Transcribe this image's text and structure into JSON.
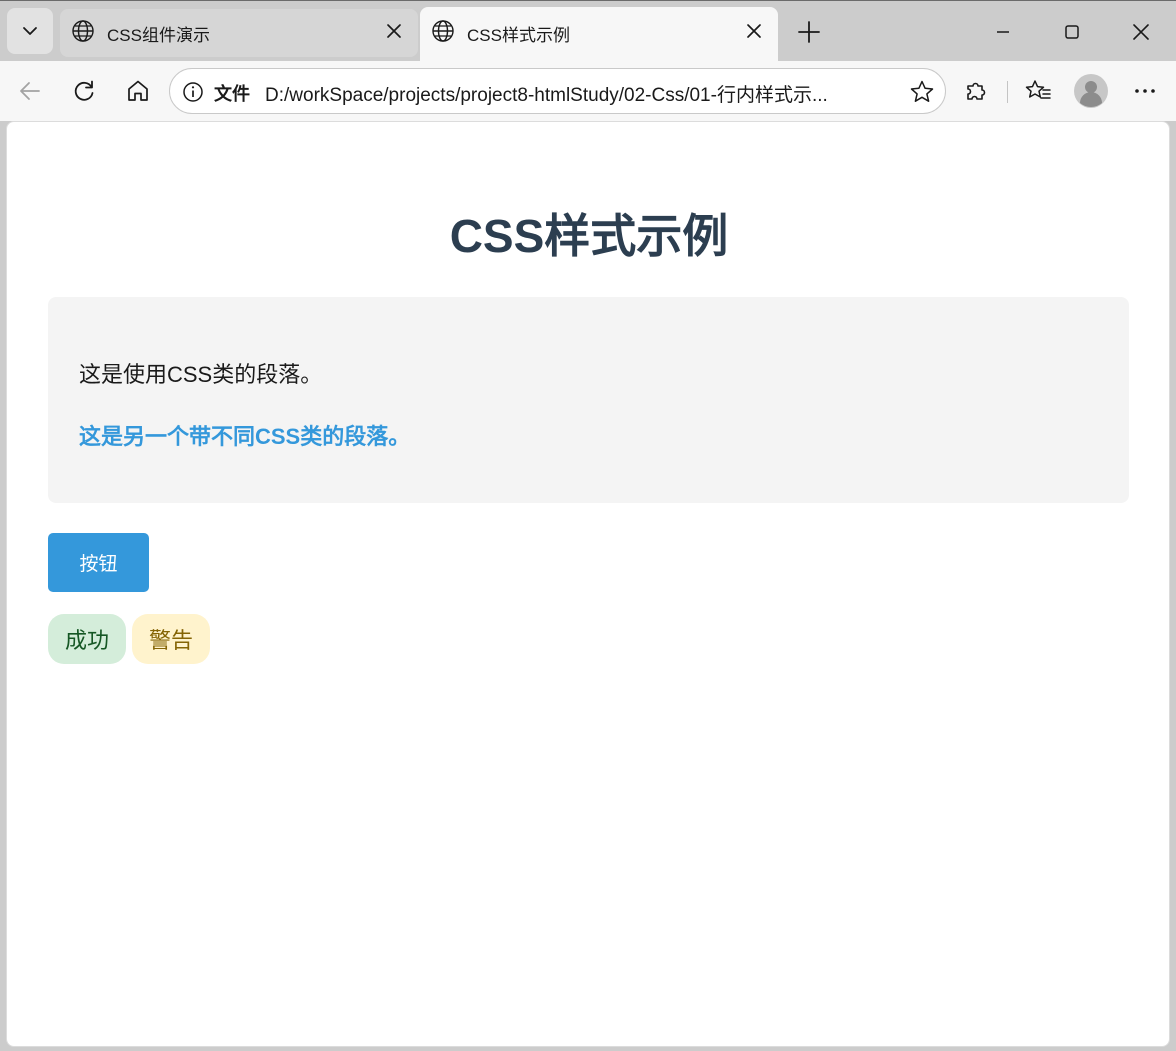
{
  "browser": {
    "tabs": [
      {
        "title": "CSS组件演示",
        "active": false
      },
      {
        "title": "CSS样式示例",
        "active": true
      }
    ],
    "address_bar": {
      "scheme_label": "文件",
      "url": "D:/workSpace/projects/project8-htmlStudy/02-Css/01-行内样式示..."
    },
    "icons": {
      "tab_menu": "chevron-down-icon",
      "favicon": "globe-icon",
      "close": "close-icon",
      "new_tab": "plus-icon",
      "back": "arrow-left-icon",
      "reload": "reload-icon",
      "home": "home-icon",
      "info": "info-icon",
      "star": "star-icon",
      "extensions": "puzzle-icon",
      "favorites": "favorites-icon",
      "profile": "avatar-icon",
      "more": "more-icon"
    }
  },
  "page": {
    "title": "CSS样式示例",
    "paragraphs": {
      "normal": "这是使用CSS类的段落。",
      "highlight": "这是另一个带不同CSS类的段落。"
    },
    "button_label": "按钮",
    "badges": {
      "success": "成功",
      "warning": "警告"
    }
  },
  "colors": {
    "title": "#2c3e50",
    "accent": "#3498db",
    "success_bg": "#d4edda",
    "success_text": "#155724",
    "warning_bg": "#fff3cd",
    "warning_text": "#856404"
  }
}
